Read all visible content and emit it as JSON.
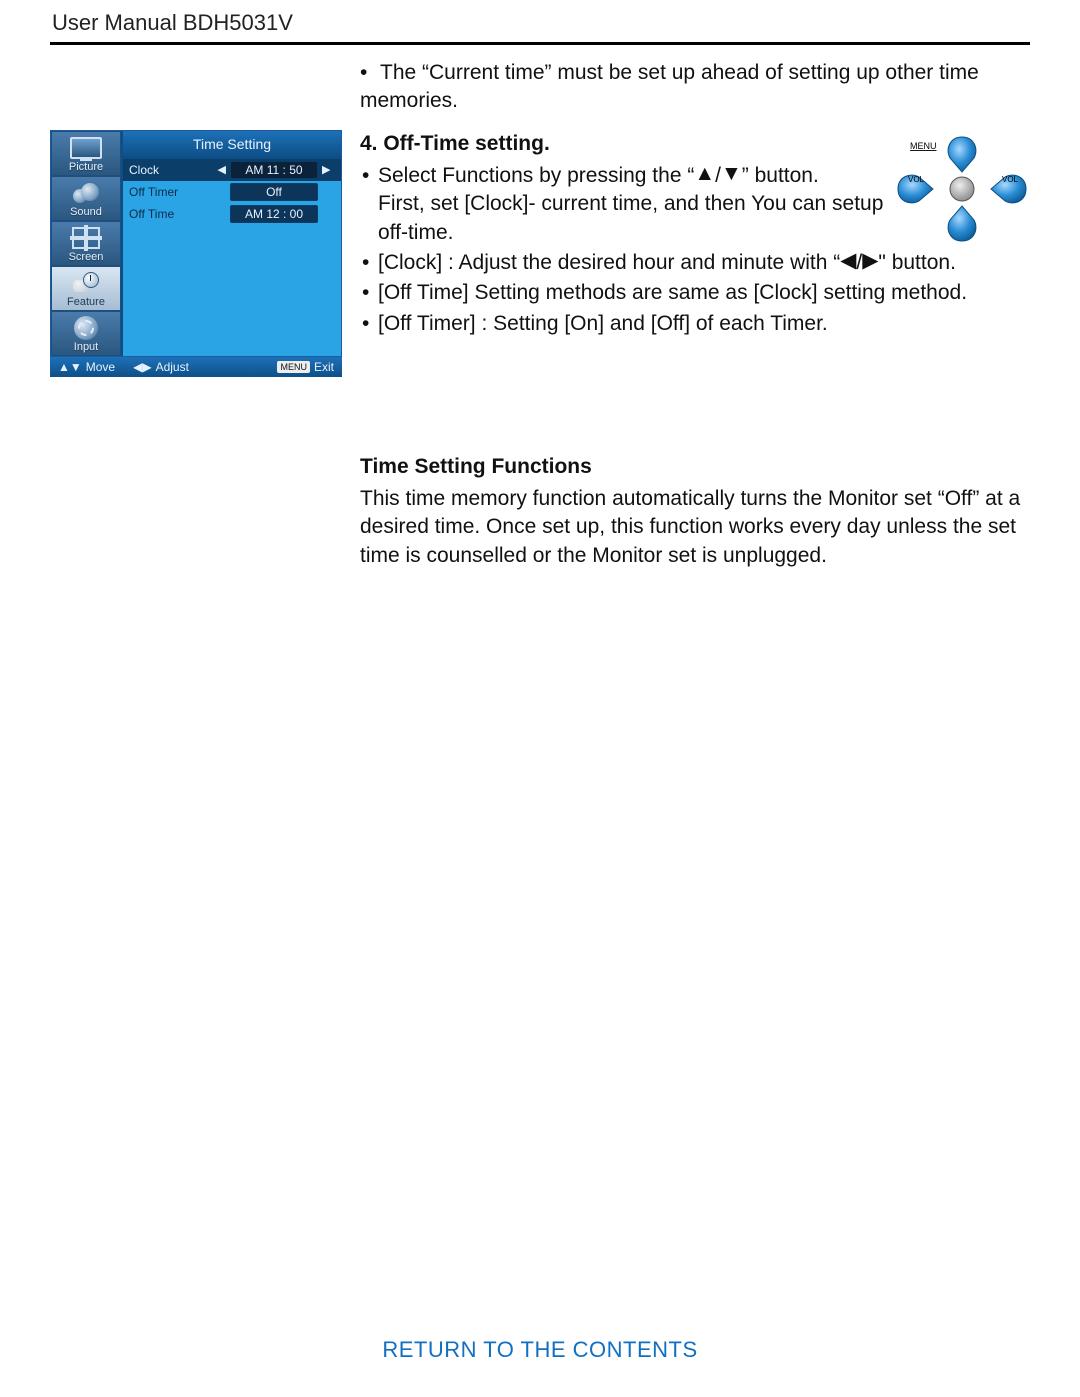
{
  "header": {
    "title": "User Manual BDH5031V"
  },
  "note": {
    "text": "The “Current time” must be set up ahead of setting up other time memories."
  },
  "osd": {
    "title": "Time Setting",
    "side_items": [
      {
        "label": "Picture",
        "icon": "monitor-icon"
      },
      {
        "label": "Sound",
        "icon": "speaker-icon"
      },
      {
        "label": "Screen",
        "icon": "screen-icon"
      },
      {
        "label": "Feature",
        "icon": "feature-icon",
        "selected": true
      },
      {
        "label": "Input",
        "icon": "gear-icon"
      }
    ],
    "rows": [
      {
        "key": "Clock",
        "value": "AM 11 : 50",
        "selected": true,
        "arrows": true
      },
      {
        "key": "Off Timer",
        "value": "Off"
      },
      {
        "key": "Off Time",
        "value": "AM 12 : 00"
      }
    ],
    "footer": {
      "move": "Move",
      "adjust": "Adjust",
      "menu_chip": "MENU",
      "exit": "Exit"
    }
  },
  "section1": {
    "title": "4. Off-Time setting.",
    "b1a": "Select Functions by pressing the “",
    "b1b": "” button.",
    "b1c": "First, set [Clock]- current time, and then You can setup off-time.",
    "b2a": "[Clock] : Adjust the desired hour and minute with “",
    "b2b": "\" button.",
    "b3": "[Off Time] Setting methods are same as [Clock] setting method.",
    "b4": "[Off Timer] : Setting [On] and [Off] of each Timer."
  },
  "section2": {
    "title": "Time Setting Functions",
    "body": "This time memory function automatically turns the Monitor set “Off” at a desired time. Once set up, this function works every day unless the set time is counselled or the Monitor set is unplugged."
  },
  "remote": {
    "menu": "MENU",
    "vol_l": "VOL",
    "vol_r": "VOL"
  },
  "footer_link": "RETURN TO THE CONTENTS"
}
